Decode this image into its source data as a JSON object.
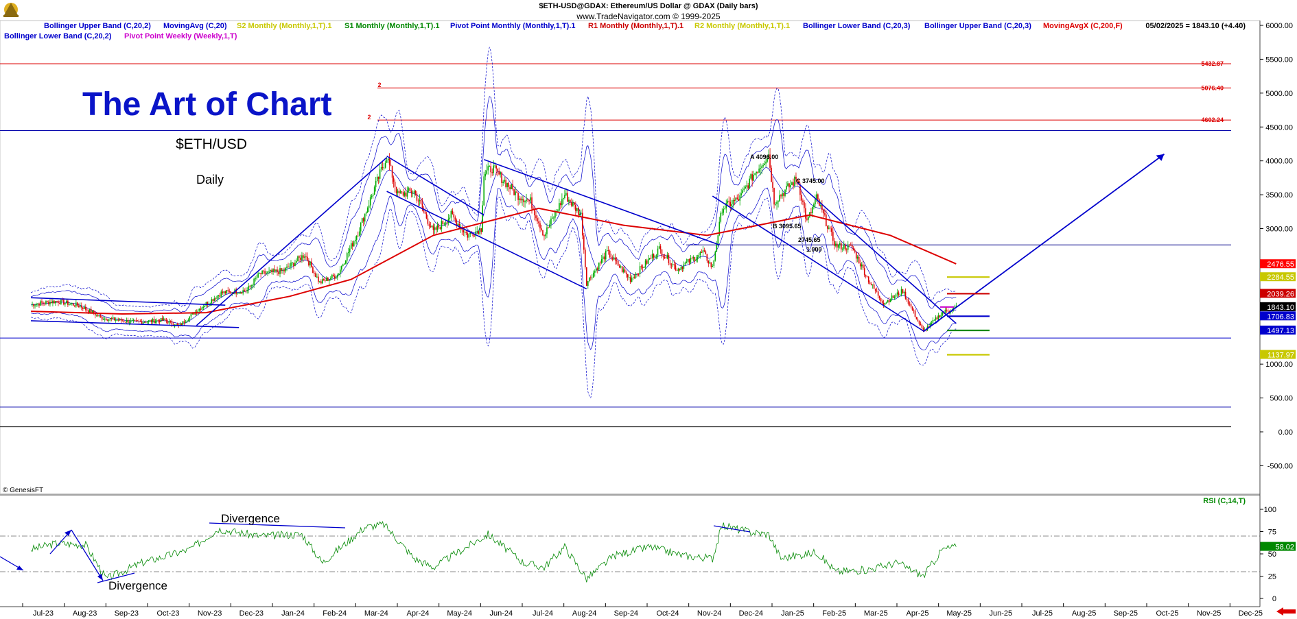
{
  "header": {
    "title": "$ETH-USD@GDAX:  Ethereum/US Dollar @ GDAX  (Daily bars)",
    "website": "www.TradeNavigator.com © 1999-2025",
    "last_readout": "05/02/2025 = 1843.10 (+4.40)",
    "copyright": "© GenesisFT"
  },
  "legend": [
    {
      "label": "Bollinger Upper Band (C,20,2)",
      "color": "#0000cc"
    },
    {
      "label": "MovingAvg (C,20)",
      "color": "#0000cc"
    },
    {
      "label": "S2 Monthly (Monthly,1,T).1",
      "color": "#c8c800"
    },
    {
      "label": "S1 Monthly (Monthly,1,T).1",
      "color": "#008800"
    },
    {
      "label": "Pivot Point Monthly (Monthly,1,T).1",
      "color": "#0000cc"
    },
    {
      "label": "R1 Monthly (Monthly,1,T).1",
      "color": "#cc0000"
    },
    {
      "label": "R2 Monthly (Monthly,1,T).1",
      "color": "#c8c800"
    },
    {
      "label": "Bollinger Lower Band (C,20,3)",
      "color": "#0000cc"
    },
    {
      "label": "Bollinger Upper Band (C,20,3)",
      "color": "#0000cc"
    },
    {
      "label": "MovingAvgX (C,200,F)",
      "color": "#dd0000"
    },
    {
      "label": "Bollinger Lower Band (C,20,2)",
      "color": "#0000cc"
    },
    {
      "label": "Pivot Point Weekly (Weekly,1,T)",
      "color": "#cc00cc"
    }
  ],
  "annotations": {
    "big_title": "The Art of Chart",
    "symbol": "$ETH/USD",
    "period": "Daily",
    "divergence_labels": [
      "Divergence",
      "Divergence"
    ],
    "wave_labels": [
      "A 4096.00",
      "C 3745.00",
      "B 3095.65",
      "2745.65",
      "1.000"
    ],
    "wave_marks": [
      "2",
      "2"
    ],
    "rsi_label": "RSI (C,14,T)"
  },
  "colors": {
    "price_up": "#00aa00",
    "price_down": "#dd0000",
    "bollinger": "#0000cc",
    "ma200": "#dd0000",
    "rsi": "#008800",
    "trendline": "#0000cc",
    "resistance": "#dd0000",
    "title_blue": "#0a14c8"
  },
  "chart_data": [
    {
      "type": "line",
      "title": "$ETH-USD@GDAX:  Ethereum/US Dollar @ GDAX  (Daily bars)",
      "y_ticks": [
        "6000.00",
        "5500.00",
        "5000.00",
        "4500.00",
        "4000.00",
        "3500.00",
        "3000.00",
        "1500.00",
        "1000.00",
        "500.00",
        "0.00",
        "-500.00"
      ],
      "ylim": [
        -750,
        6000
      ],
      "x_ticks": [
        "Jul-23",
        "Aug-23",
        "Sep-23",
        "Oct-23",
        "Nov-23",
        "Dec-23",
        "Jan-24",
        "Feb-24",
        "Mar-24",
        "Apr-24",
        "May-24",
        "Jun-24",
        "Jul-24",
        "Aug-24",
        "Sep-24",
        "Oct-24",
        "Nov-24",
        "Dec-24",
        "Jan-25",
        "Feb-25",
        "Mar-25",
        "Apr-25",
        "May-25",
        "Jun-25",
        "Jul-25",
        "Aug-25",
        "Sep-25",
        "Oct-25",
        "Nov-25",
        "Dec-25"
      ],
      "series": [
        {
          "name": "$ETH-USD@GDAX",
          "points": [
            [
              "2023-06-26",
              1880
            ],
            [
              "2023-07-15",
              1930
            ],
            [
              "2023-08-01",
              1860
            ],
            [
              "2023-08-17",
              1680
            ],
            [
              "2023-09-10",
              1620
            ],
            [
              "2023-10-01",
              1650
            ],
            [
              "2023-10-12",
              1560
            ],
            [
              "2023-10-25",
              1790
            ],
            [
              "2023-11-12",
              2050
            ],
            [
              "2023-12-01",
              2090
            ],
            [
              "2023-12-10",
              2330
            ],
            [
              "2023-12-28",
              2380
            ],
            [
              "2024-01-12",
              2620
            ],
            [
              "2024-01-23",
              2200
            ],
            [
              "2024-02-05",
              2320
            ],
            [
              "2024-02-20",
              2950
            ],
            [
              "2024-03-05",
              3700
            ],
            [
              "2024-03-12",
              4070
            ],
            [
              "2024-03-20",
              3500
            ],
            [
              "2024-04-01",
              3550
            ],
            [
              "2024-04-15",
              2950
            ],
            [
              "2024-04-28",
              3200
            ],
            [
              "2024-05-10",
              2900
            ],
            [
              "2024-05-20",
              3000
            ],
            [
              "2024-05-22",
              3800
            ],
            [
              "2024-05-28",
              3900
            ],
            [
              "2024-06-15",
              3500
            ],
            [
              "2024-06-25",
              3400
            ],
            [
              "2024-07-05",
              2900
            ],
            [
              "2024-07-20",
              3500
            ],
            [
              "2024-08-01",
              3200
            ],
            [
              "2024-08-05",
              2200
            ],
            [
              "2024-08-20",
              2650
            ],
            [
              "2024-09-06",
              2250
            ],
            [
              "2024-09-27",
              2700
            ],
            [
              "2024-10-10",
              2400
            ],
            [
              "2024-10-29",
              2650
            ],
            [
              "2024-11-05",
              2420
            ],
            [
              "2024-11-12",
              3300
            ],
            [
              "2024-11-25",
              3450
            ],
            [
              "2024-12-05",
              3800
            ],
            [
              "2024-12-16",
              4096
            ],
            [
              "2024-12-20",
              3400
            ],
            [
              "2025-01-06",
              3745
            ],
            [
              "2025-01-13",
              3095
            ],
            [
              "2025-01-20",
              3450
            ],
            [
              "2025-02-03",
              2745
            ],
            [
              "2025-02-15",
              2720
            ],
            [
              "2025-02-28",
              2200
            ],
            [
              "2025-03-10",
              1900
            ],
            [
              "2025-03-24",
              2080
            ],
            [
              "2025-04-08",
              1480
            ],
            [
              "2025-04-22",
              1760
            ],
            [
              "2025-05-02",
              1843.1
            ]
          ]
        },
        {
          "name": "MovingAvgX (C,200,F)",
          "points": [
            [
              "2023-06-26",
              1780
            ],
            [
              "2023-09-01",
              1740
            ],
            [
              "2023-11-01",
              1760
            ],
            [
              "2024-01-01",
              2000
            ],
            [
              "2024-02-15",
              2250
            ],
            [
              "2024-04-15",
              2900
            ],
            [
              "2024-07-01",
              3300
            ],
            [
              "2024-09-01",
              3050
            ],
            [
              "2024-11-01",
              2900
            ],
            [
              "2025-01-15",
              3200
            ],
            [
              "2025-03-15",
              2900
            ],
            [
              "2025-05-02",
              2480
            ]
          ]
        }
      ],
      "levels": [
        {
          "value": 5432.87,
          "label": "5432.87"
        },
        {
          "value": 5076.4,
          "label": "5076.40"
        },
        {
          "value": 4602.24,
          "label": "4602.24"
        }
      ],
      "price_tags": [
        {
          "value": 2476.55,
          "label": "2476.55",
          "bg": "#ff0000",
          "fg": "#ffffff"
        },
        {
          "value": 2284.55,
          "label": "2284.55",
          "bg": "#c8c800",
          "fg": "#ffffff"
        },
        {
          "value": 2039.26,
          "label": "2039.26",
          "bg": "#cc0000",
          "fg": "#ffffff"
        },
        {
          "value": 1843.1,
          "label": "1843.10",
          "bg": "#000000",
          "fg": "#ffffff"
        },
        {
          "value": 1706.83,
          "label": "1706.83",
          "bg": "#0000cc",
          "fg": "#ffffff"
        },
        {
          "value": 1497.13,
          "label": "1497.13",
          "bg": "#0000cc",
          "fg": "#ffffff"
        },
        {
          "value": 1137.97,
          "label": "1137.97",
          "bg": "#c8c800",
          "fg": "#ffffff"
        }
      ],
      "pivots_may25": [
        {
          "name": "R2",
          "value": 2284.55
        },
        {
          "name": "R1",
          "value": 2039.26
        },
        {
          "name": "Pivot Point",
          "value": 1706.83
        },
        {
          "name": "S1",
          "value": 1497.13
        },
        {
          "name": "S2",
          "value": 1137.97
        }
      ],
      "grid": true
    },
    {
      "type": "line",
      "title": "RSI (C,14,T)",
      "y_ticks": [
        "100",
        "75",
        "50",
        "25",
        "0"
      ],
      "ylim": [
        0,
        100
      ],
      "reference_lines": [
        70,
        30
      ],
      "last_value": "58.02",
      "series": [
        {
          "name": "RSI (C,14,T)",
          "points": [
            [
              "2023-06-26",
              55
            ],
            [
              "2023-07-15",
              62
            ],
            [
              "2023-08-05",
              60
            ],
            [
              "2023-08-20",
              22
            ],
            [
              "2023-09-15",
              40
            ],
            [
              "2023-10-20",
              55
            ],
            [
              "2023-11-10",
              78
            ],
            [
              "2023-12-10",
              70
            ],
            [
              "2024-01-10",
              72
            ],
            [
              "2024-01-25",
              40
            ],
            [
              "2024-02-25",
              80
            ],
            [
              "2024-03-10",
              83
            ],
            [
              "2024-04-01",
              45
            ],
            [
              "2024-04-15",
              35
            ],
            [
              "2024-05-01",
              50
            ],
            [
              "2024-05-25",
              72
            ],
            [
              "2024-06-20",
              40
            ],
            [
              "2024-07-05",
              35
            ],
            [
              "2024-07-20",
              58
            ],
            [
              "2024-08-05",
              22
            ],
            [
              "2024-08-25",
              48
            ],
            [
              "2024-09-20",
              58
            ],
            [
              "2024-10-15",
              48
            ],
            [
              "2024-11-05",
              45
            ],
            [
              "2024-11-12",
              82
            ],
            [
              "2024-12-01",
              75
            ],
            [
              "2024-12-16",
              72
            ],
            [
              "2024-12-25",
              45
            ],
            [
              "2025-01-20",
              52
            ],
            [
              "2025-02-03",
              30
            ],
            [
              "2025-02-25",
              32
            ],
            [
              "2025-03-20",
              40
            ],
            [
              "2025-04-08",
              25
            ],
            [
              "2025-04-22",
              55
            ],
            [
              "2025-05-02",
              58.02
            ]
          ]
        }
      ]
    }
  ]
}
